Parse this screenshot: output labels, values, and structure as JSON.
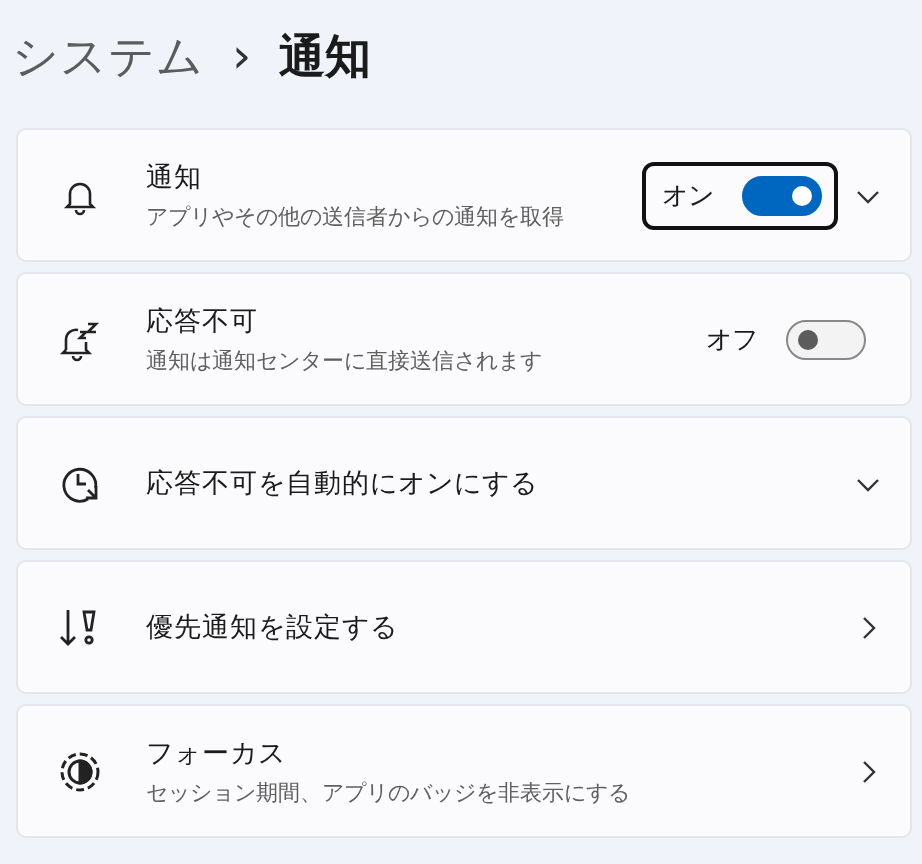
{
  "breadcrumb": {
    "parent": "システム",
    "separator": "›",
    "current": "通知"
  },
  "items": [
    {
      "title": "通知",
      "subtitle": "アプリやその他の送信者からの通知を取得",
      "toggle": {
        "label": "オン",
        "on": true,
        "focused": true
      },
      "kind": "expandable"
    },
    {
      "title": "応答不可",
      "subtitle": "通知は通知センターに直接送信されます",
      "toggle": {
        "label": "オフ",
        "on": false,
        "focused": false
      },
      "kind": "plain"
    },
    {
      "title": "応答不可を自動的にオンにする",
      "kind": "expandable"
    },
    {
      "title": "優先通知を設定する",
      "kind": "link"
    },
    {
      "title": "フォーカス",
      "subtitle": "セッション期間、アプリのバッジを非表示にする",
      "kind": "link"
    }
  ]
}
